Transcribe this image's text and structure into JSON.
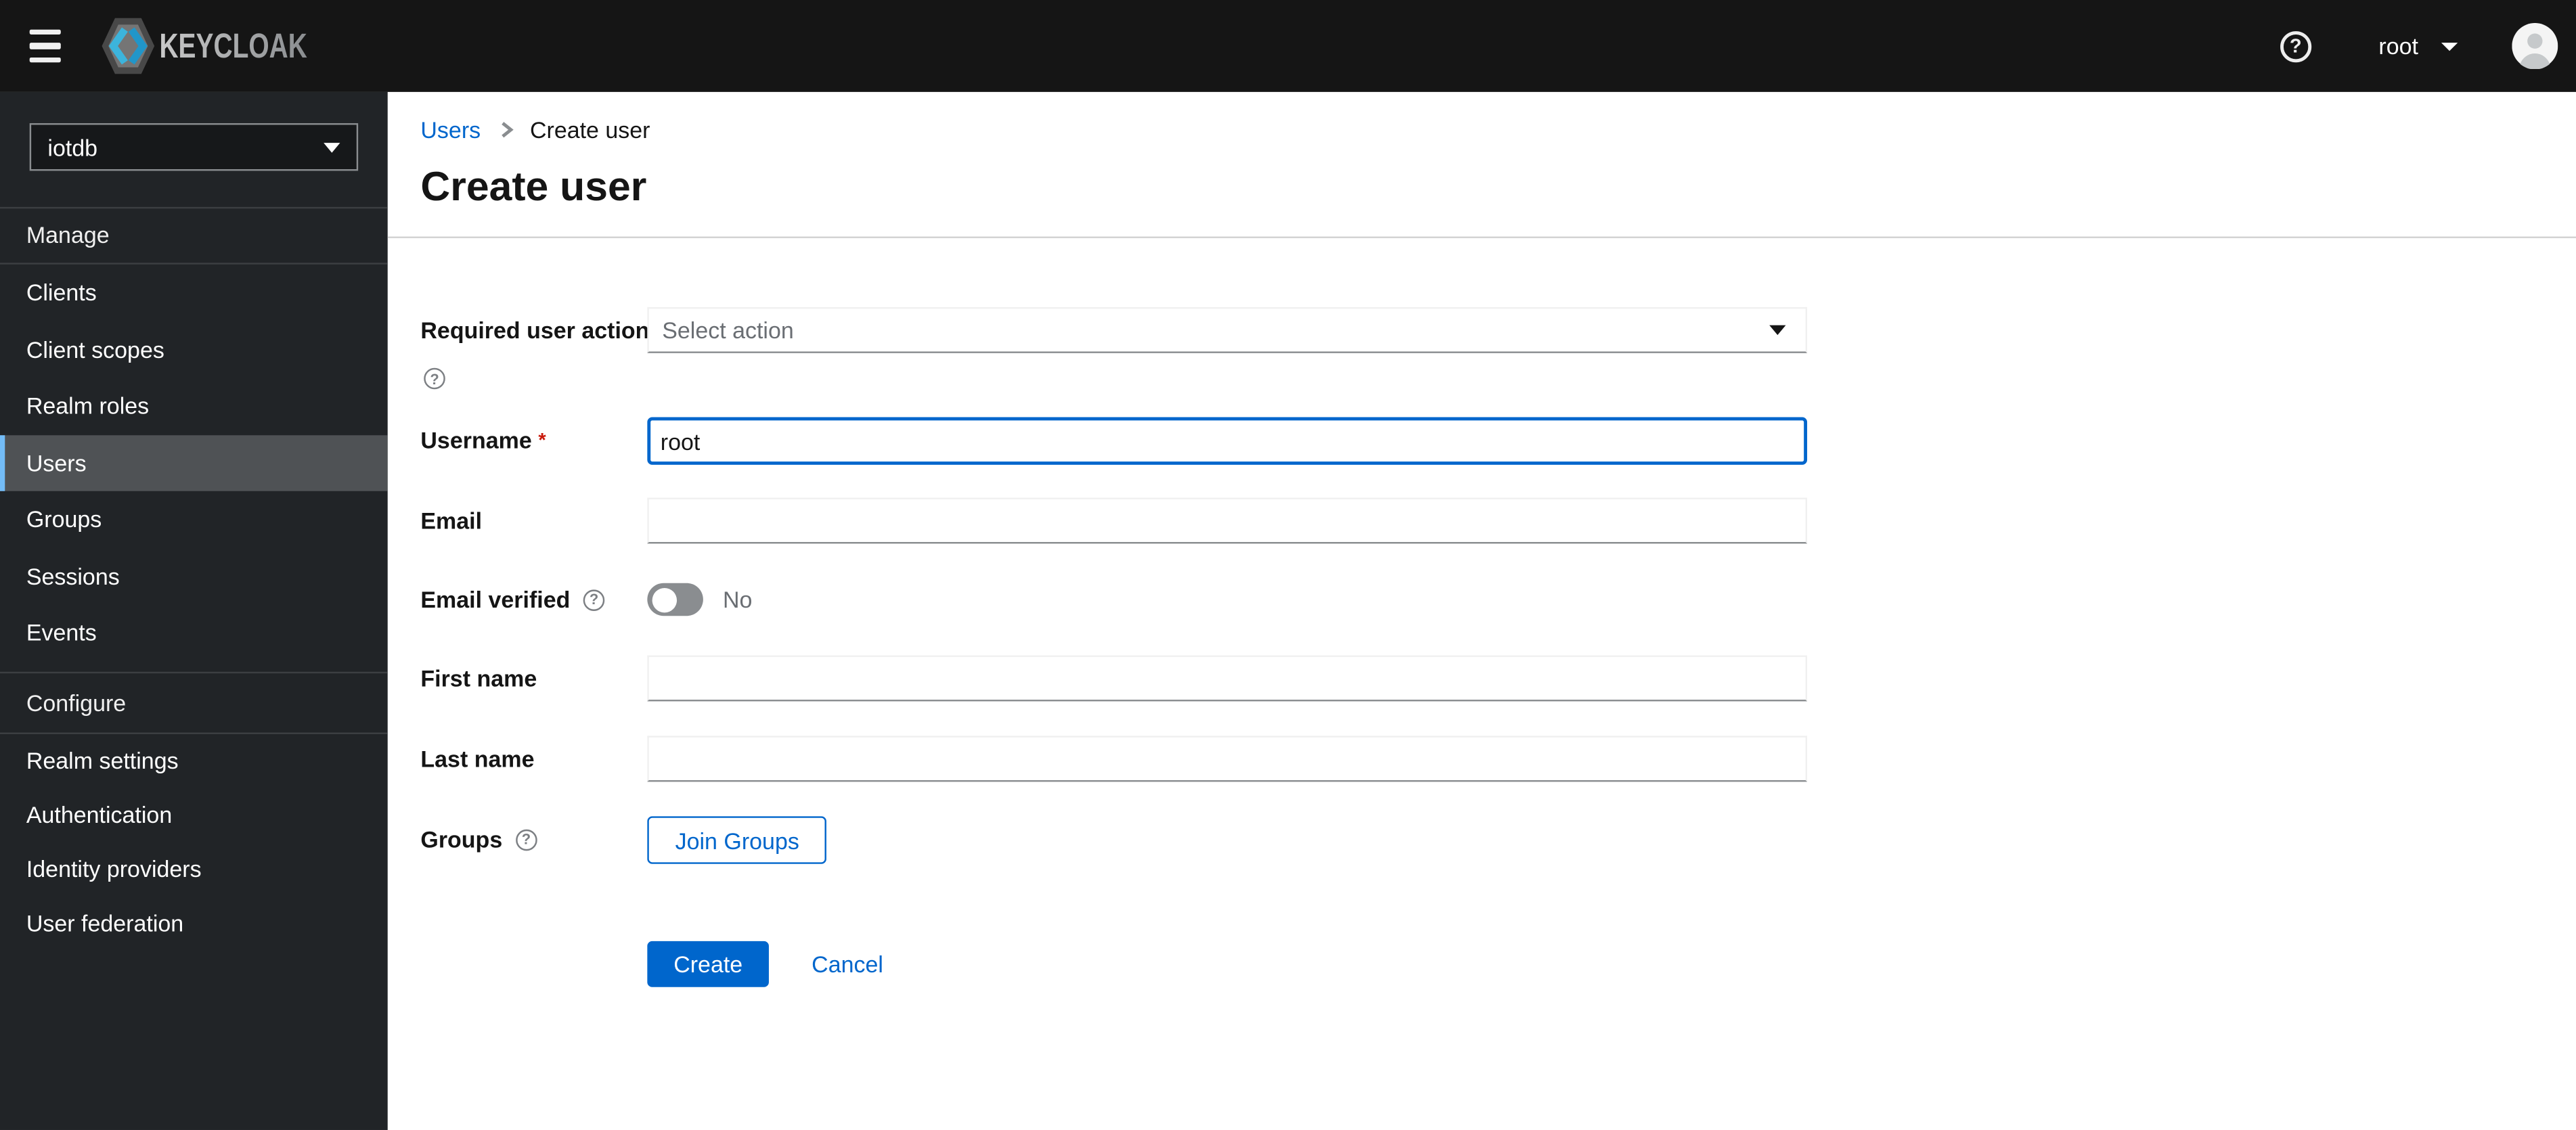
{
  "topbar": {
    "brand": "KEYCLOAK",
    "username": "root"
  },
  "sidebar": {
    "realm": "iotdb",
    "sections": [
      {
        "label": "Manage",
        "items": [
          "Clients",
          "Client scopes",
          "Realm roles",
          "Users",
          "Groups",
          "Sessions",
          "Events"
        ]
      },
      {
        "label": "Configure",
        "items": [
          "Realm settings",
          "Authentication",
          "Identity providers",
          "User federation"
        ]
      }
    ],
    "selected_item": "Users"
  },
  "breadcrumb": {
    "parent": "Users",
    "current": "Create user"
  },
  "page": {
    "title": "Create user"
  },
  "form": {
    "required_user_actions": {
      "label": "Required user actions",
      "placeholder": "Select action"
    },
    "username": {
      "label": "Username",
      "required_indicator": "*",
      "value": "root"
    },
    "email": {
      "label": "Email",
      "value": ""
    },
    "email_verified": {
      "label": "Email verified",
      "state_label": "No",
      "state": "off"
    },
    "first_name": {
      "label": "First name",
      "value": ""
    },
    "last_name": {
      "label": "Last name",
      "value": ""
    },
    "groups": {
      "label": "Groups",
      "button_label": "Join Groups"
    }
  },
  "actions": {
    "create": "Create",
    "cancel": "Cancel"
  },
  "icons": {
    "question": "?"
  },
  "colors": {
    "primary": "#0066cc",
    "masthead_bg": "#151515",
    "sidebar_bg": "#212427",
    "nav_selected_bg": "#4f5255",
    "nav_selected_accent": "#73bcf7",
    "required_red": "#c9190b",
    "input_border_bottom": "#8a8d90",
    "muted_text": "#6a6e73",
    "logo_cyan": "#3cb4dc"
  }
}
